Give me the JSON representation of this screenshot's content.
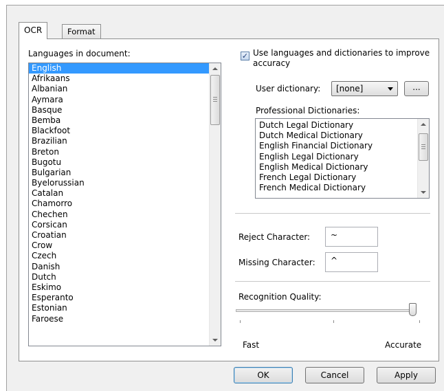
{
  "tabs": {
    "ocr": "OCR",
    "format": "Format"
  },
  "languages": {
    "label": "Languages in document:",
    "selected": "English",
    "items": [
      "English",
      "Afrikaans",
      "Albanian",
      "Aymara",
      "Basque",
      "Bemba",
      "Blackfoot",
      "Brazilian",
      "Breton",
      "Bugotu",
      "Bulgarian",
      "Byelorussian",
      "Catalan",
      "Chamorro",
      "Chechen",
      "Corsican",
      "Croatian",
      "Crow",
      "Czech",
      "Danish",
      "Dutch",
      "Eskimo",
      "Esperanto",
      "Estonian",
      "Faroese"
    ]
  },
  "use_dictionaries": {
    "checked": true,
    "label_line1": "Use languages and dictionaries to improve",
    "label_line2": "accuracy"
  },
  "user_dictionary": {
    "label": "User dictionary:",
    "value": "[none]",
    "browse_label": "..."
  },
  "professional": {
    "label": "Professional Dictionaries:",
    "items": [
      "Dutch Legal Dictionary",
      "Dutch Medical Dictionary",
      "English Financial Dictionary",
      "English Legal Dictionary",
      "English Medical Dictionary",
      "French Legal Dictionary",
      "French Medical Dictionary"
    ]
  },
  "reject": {
    "label": "Reject Character:",
    "value": "~"
  },
  "missing": {
    "label": "Missing Character:",
    "value": "^"
  },
  "quality": {
    "label": "Recognition Quality:",
    "min_label": "Fast",
    "max_label": "Accurate",
    "level": 1.0
  },
  "buttons": {
    "ok": "OK",
    "cancel": "Cancel",
    "apply": "Apply"
  },
  "colors": {
    "selection": "#3399ff",
    "dialog_bg": "#f0f0f0",
    "ok_border": "#3c7fb1"
  }
}
